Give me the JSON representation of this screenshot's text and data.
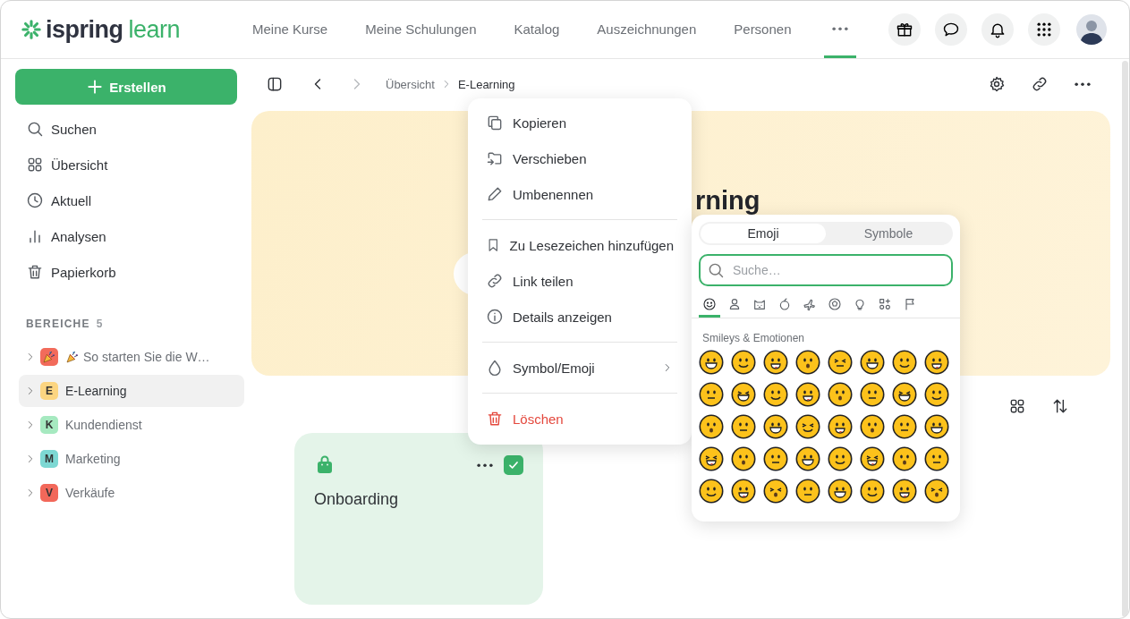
{
  "header": {
    "logo": {
      "word_1": "ispring",
      "word_2": "learn"
    },
    "nav": [
      {
        "kind": "link",
        "label": "Meine Kurse",
        "selected": false
      },
      {
        "kind": "link",
        "label": "Meine Schulungen",
        "selected": false
      },
      {
        "kind": "link",
        "label": "Katalog",
        "selected": false
      },
      {
        "kind": "link",
        "label": "Auszeichnungen",
        "selected": false
      },
      {
        "kind": "link",
        "label": "Personen",
        "selected": false
      },
      {
        "kind": "more",
        "selected": true
      }
    ],
    "actions": [
      {
        "kind": "gift"
      },
      {
        "kind": "chat"
      },
      {
        "kind": "bell"
      },
      {
        "kind": "apps"
      }
    ]
  },
  "sidebar": {
    "create_button": "Erstellen",
    "nav": [
      {
        "kind": "search",
        "label": "Suchen"
      },
      {
        "kind": "overview",
        "label": "Übersicht"
      },
      {
        "kind": "recent",
        "label": "Aktuell"
      },
      {
        "kind": "analytics",
        "label": "Analysen"
      },
      {
        "kind": "trash",
        "label": "Papierkorb"
      }
    ],
    "spaces_heading": "BEREICHE",
    "spaces_count": "5",
    "spaces": [
      {
        "kind": "emoji",
        "label": "So starten Sie die W…",
        "color": "#f26b5b",
        "selected": false
      },
      {
        "kind": "letter",
        "badge": "E",
        "label": "E-Learning",
        "color": "#fcd581",
        "selected": true
      },
      {
        "kind": "letter",
        "badge": "K",
        "label": "Kundendienst",
        "color": "#a6e9c0",
        "selected": false
      },
      {
        "kind": "letter",
        "badge": "M",
        "label": "Marketing",
        "color": "#7dd8d3",
        "selected": false
      },
      {
        "kind": "letter",
        "badge": "V",
        "label": "Verkäufe",
        "color": "#f2685a",
        "selected": false
      }
    ]
  },
  "toolbar": {
    "nav_buttons": [
      {
        "kind": "back",
        "disabled": false
      },
      {
        "kind": "forward",
        "disabled": true
      }
    ],
    "breadcrumb": [
      {
        "label": "Übersicht",
        "current": false
      },
      {
        "label": "E-Learning",
        "current": true
      }
    ],
    "actions": [
      {
        "kind": "settings"
      },
      {
        "kind": "link"
      },
      {
        "kind": "more"
      }
    ]
  },
  "hero": {
    "title": "rning"
  },
  "cards": [
    {
      "title": "Onboarding",
      "checked": true
    }
  ],
  "context_menu": {
    "groups": [
      [
        {
          "kind": "copy",
          "label": "Kopieren",
          "has_submenu": false
        },
        {
          "kind": "move",
          "label": "Verschieben",
          "has_submenu": false
        },
        {
          "kind": "rename",
          "label": "Umbenennen",
          "has_submenu": false
        }
      ],
      [
        {
          "kind": "bookmark",
          "label": "Zu Lesezeichen hinzufügen",
          "has_submenu": false
        },
        {
          "kind": "share",
          "label": "Link teilen",
          "has_submenu": false
        },
        {
          "kind": "details",
          "label": "Details anzeigen",
          "has_submenu": false
        }
      ],
      [
        {
          "kind": "icon",
          "label": "Symbol/Emoji",
          "has_submenu": true
        }
      ],
      [
        {
          "kind": "delete",
          "label": "Löschen",
          "has_submenu": false
        }
      ]
    ]
  },
  "emoji_picker": {
    "tabs": [
      {
        "label": "Emoji",
        "selected": true
      },
      {
        "label": "Symbole",
        "selected": false
      }
    ],
    "search": {
      "placeholder": "Suche…"
    },
    "categories": [
      {
        "kind": "smileys",
        "selected": true
      },
      {
        "kind": "people",
        "selected": false
      },
      {
        "kind": "animals",
        "selected": false
      },
      {
        "kind": "food",
        "selected": false
      },
      {
        "kind": "travel",
        "selected": false
      },
      {
        "kind": "activities",
        "selected": false
      },
      {
        "kind": "objects",
        "selected": false
      },
      {
        "kind": "symbols",
        "selected": false
      },
      {
        "kind": "flags",
        "selected": false
      }
    ],
    "section_title": "Smileys & Emotionen"
  }
}
